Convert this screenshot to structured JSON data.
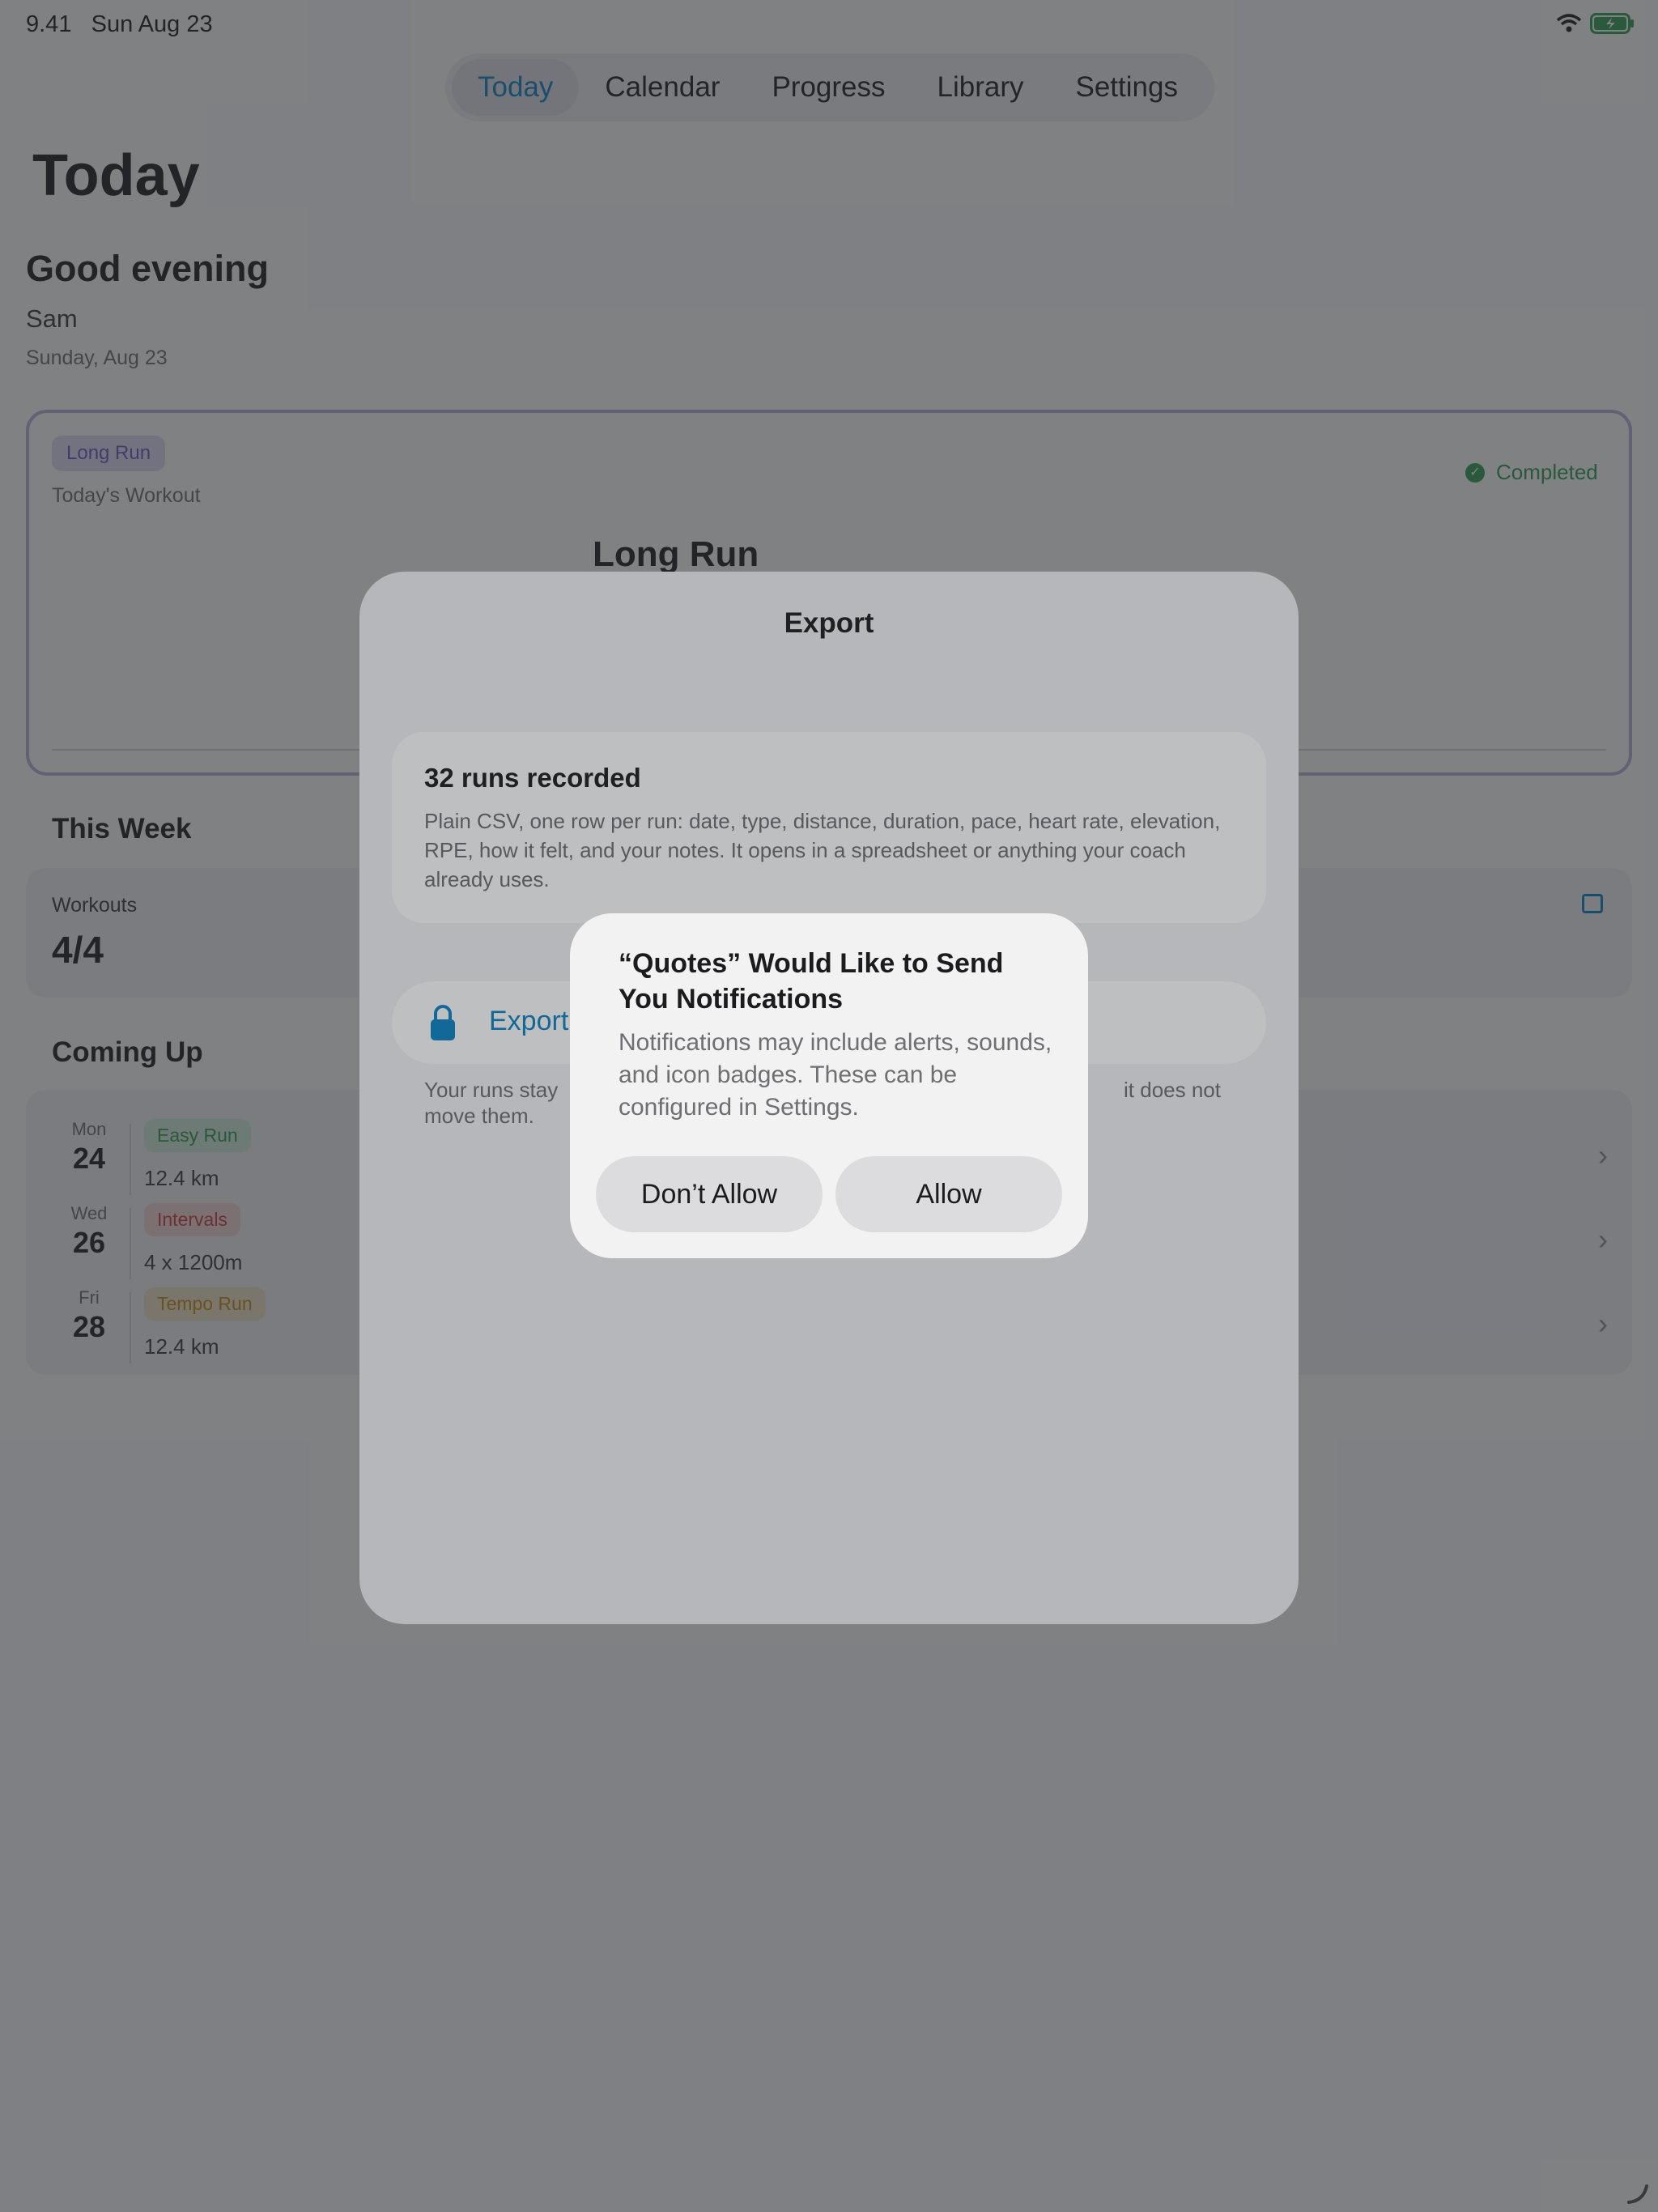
{
  "status_bar": {
    "time": "9.41",
    "date": "Sun Aug 23"
  },
  "tabs": [
    {
      "label": "Today",
      "active": true
    },
    {
      "label": "Calendar"
    },
    {
      "label": "Progress"
    },
    {
      "label": "Library"
    },
    {
      "label": "Settings"
    }
  ],
  "page": {
    "title": "Today",
    "greeting": "Good evening",
    "user_name": "Sam",
    "date": "Sunday, Aug 23"
  },
  "todays_workout": {
    "tag": "Long Run",
    "subtitle": "Today's Workout",
    "status": "Completed",
    "title": "Long Run"
  },
  "this_week": {
    "section_title": "This Week",
    "workouts_label": "Workouts",
    "workouts_value": "4/4"
  },
  "coming_up": {
    "section_title": "Coming Up",
    "items": [
      {
        "day_name": "Mon",
        "day_num": "24",
        "type": "Easy Run",
        "detail": "12.4 km",
        "color": "#2e9e4f",
        "bg": "#d6efdc"
      },
      {
        "day_name": "Wed",
        "day_num": "26",
        "type": "Intervals",
        "detail": "4 x 1200m",
        "color": "#d23b3b",
        "bg": "#f6d6d6"
      },
      {
        "day_name": "Fri",
        "day_num": "28",
        "type": "Tempo Run",
        "detail": "12.4 km",
        "color": "#c98a10",
        "bg": "#f6e6c4"
      }
    ]
  },
  "export_sheet": {
    "title": "Export",
    "runs_title": "32 runs recorded",
    "runs_body": "Plain CSV, one row per run: date, type, distance, duration, pace, heart rate, elevation, RPE, how it felt, and your notes. It opens in a spreadsheet or anything your coach already uses.",
    "export_button": "Export",
    "privacy_note_start": "Your runs stay",
    "privacy_note_end": "it does not",
    "privacy_note_line2": "move them."
  },
  "alert": {
    "title": "“Quotes” Would Like to Send You Notifications",
    "body": "Notifications may include alerts, sounds, and icon badges. These can be configured in Settings.",
    "deny_label": "Don’t Allow",
    "allow_label": "Allow"
  },
  "colors": {
    "accent": "#0a84c6",
    "success": "#2e9e4f",
    "long_run": "#6c55c8"
  }
}
